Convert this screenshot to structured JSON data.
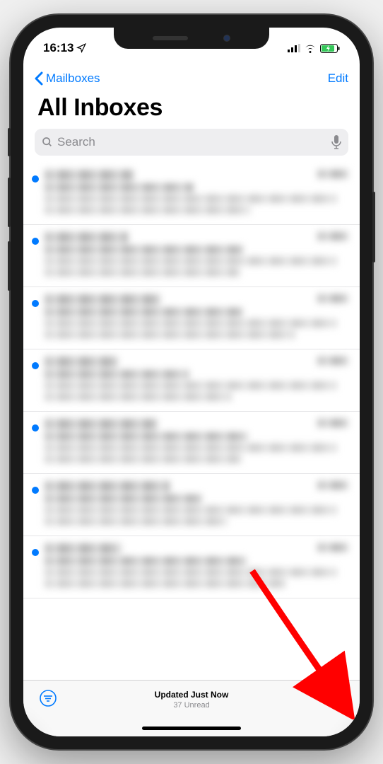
{
  "status_bar": {
    "time": "16:13"
  },
  "nav": {
    "back_label": "Mailboxes",
    "edit_label": "Edit"
  },
  "page": {
    "title": "All Inboxes"
  },
  "search": {
    "placeholder": "Search"
  },
  "messages": [
    {
      "unread": true
    },
    {
      "unread": true
    },
    {
      "unread": true
    },
    {
      "unread": true
    },
    {
      "unread": true
    },
    {
      "unread": true
    },
    {
      "unread": true
    }
  ],
  "toolbar": {
    "updated_label": "Updated Just Now",
    "unread_label": "37 Unread"
  },
  "colors": {
    "ios_blue": "#007aff"
  }
}
